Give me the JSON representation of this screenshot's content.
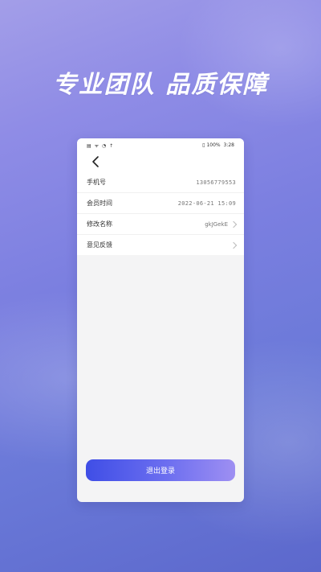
{
  "banner": {
    "headline": "专业团队 品质保障"
  },
  "status_bar": {
    "left": "▤ ᯤ ◔ ↑",
    "battery": "100%",
    "time": "3:28"
  },
  "profile": {
    "rows": [
      {
        "label": "手机号",
        "value": "13056779553",
        "has_arrow": false
      },
      {
        "label": "会员时间",
        "value": "2022-06-21 15:09",
        "has_arrow": false
      },
      {
        "label": "修改名称",
        "value": "gkJGekE",
        "has_arrow": true
      },
      {
        "label": "意见反馈",
        "value": "",
        "has_arrow": true
      }
    ],
    "logout_label": "退出登录"
  },
  "colors": {
    "button_start": "#3f4ee6",
    "button_end": "#9e8ff2",
    "background_top": "#a39ee8",
    "background_bottom": "#5c68cc"
  }
}
